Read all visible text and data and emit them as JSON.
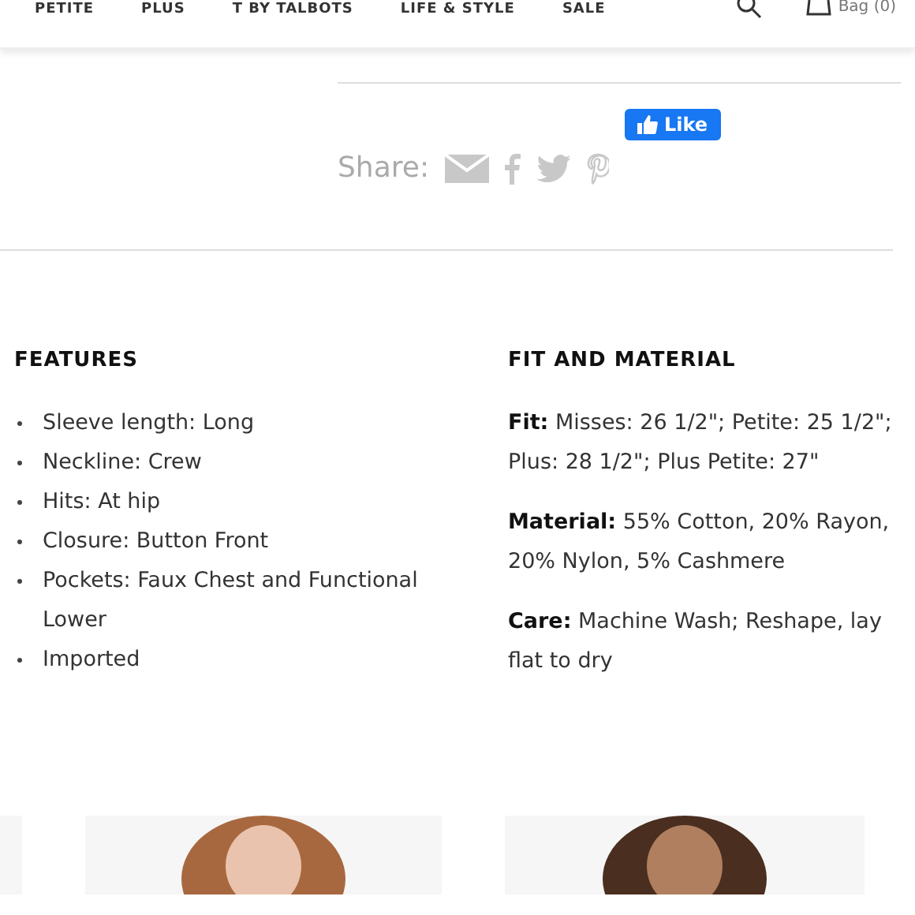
{
  "nav": {
    "items": [
      "PETITE",
      "PLUS",
      "T BY TALBOTS",
      "LIFE & STYLE",
      "SALE"
    ],
    "bag": "Bag (0)"
  },
  "share": {
    "label": "Share:",
    "like": "Like"
  },
  "features": {
    "title": "FEATURES",
    "items": [
      "Sleeve length: Long",
      "Neckline: Crew",
      "Hits: At hip",
      "Closure: Button Front",
      "Pockets: Faux Chest and Functional Lower",
      "Imported"
    ]
  },
  "fit": {
    "title": "FIT AND MATERIAL",
    "paragraphs": [
      "**Fit:** Misses: 26 1/2\"; Petite: 25 1/2\"; Plus: 28 1/2\"; Plus Petite: 27\"",
      "**Material:** 55% Cotton, 20% Rayon, 20% Nylon, 5% Cashmere",
      "**Care:** Machine Wash; Reshape, lay flat to dry"
    ]
  }
}
